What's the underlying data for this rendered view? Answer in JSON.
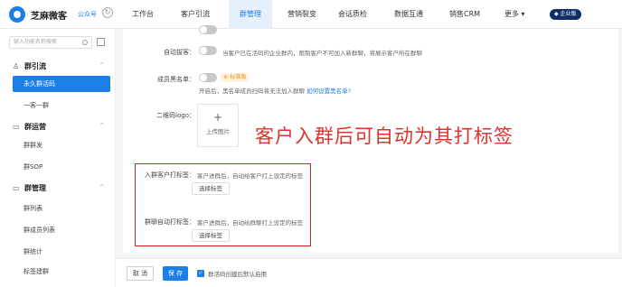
{
  "app": {
    "brand": "芝麻微客",
    "sub": "公众号"
  },
  "nav": [
    {
      "label": "工作台"
    },
    {
      "label": "客户引流"
    },
    {
      "label": "群管理"
    },
    {
      "label": "营销裂变"
    },
    {
      "label": "会话质检"
    },
    {
      "label": "数据互通"
    },
    {
      "label": "销售CRM"
    },
    {
      "label": "更多 ▾"
    }
  ],
  "enterprise_badge": "企业版",
  "sidebar": {
    "search_placeholder": "输入功能名称搜索",
    "groups": [
      {
        "label": "群引流",
        "icon": "person-icon",
        "items": [
          "永久群活码",
          "一客一群"
        ]
      },
      {
        "label": "群运营",
        "icon": "chat-icon",
        "items": [
          "群群发",
          "群SOP"
        ]
      },
      {
        "label": "群管理",
        "icon": "manage-icon",
        "items": [
          "群列表",
          "群成员列表",
          "群统计",
          "标签建群"
        ]
      }
    ]
  },
  "form": {
    "auto_remove_label": "自动拔客：",
    "auto_remove_hint": "当客户已在活码的企业群内，限制客户不可加入新群聊，将展示客户所在群聊",
    "whitelist_label": "成员黑名单：",
    "pro_tag": "标准版",
    "whitelist_hint": "开启后，黑名单成员扫码将无法加入群聊",
    "whitelist_link": "如何设置黑名单?",
    "qr_logo_label": "二维码logo：",
    "upload_plus": "+",
    "upload_text": "上传图片",
    "customer_tag_label": "入群客户打标签：",
    "customer_tag_hint": "客户进群后，自动给客户打上设定的标签",
    "group_tag_label": "群聊自动打标签：",
    "group_tag_hint": "客户进群后，自动给群聊打上设定的标签",
    "select_tag": "选择标签"
  },
  "annotation": "客户入群后可自动为其打标签",
  "footer": {
    "cancel": "取 消",
    "save": "保 存",
    "default_enable": "群活码创建后默认启用"
  }
}
